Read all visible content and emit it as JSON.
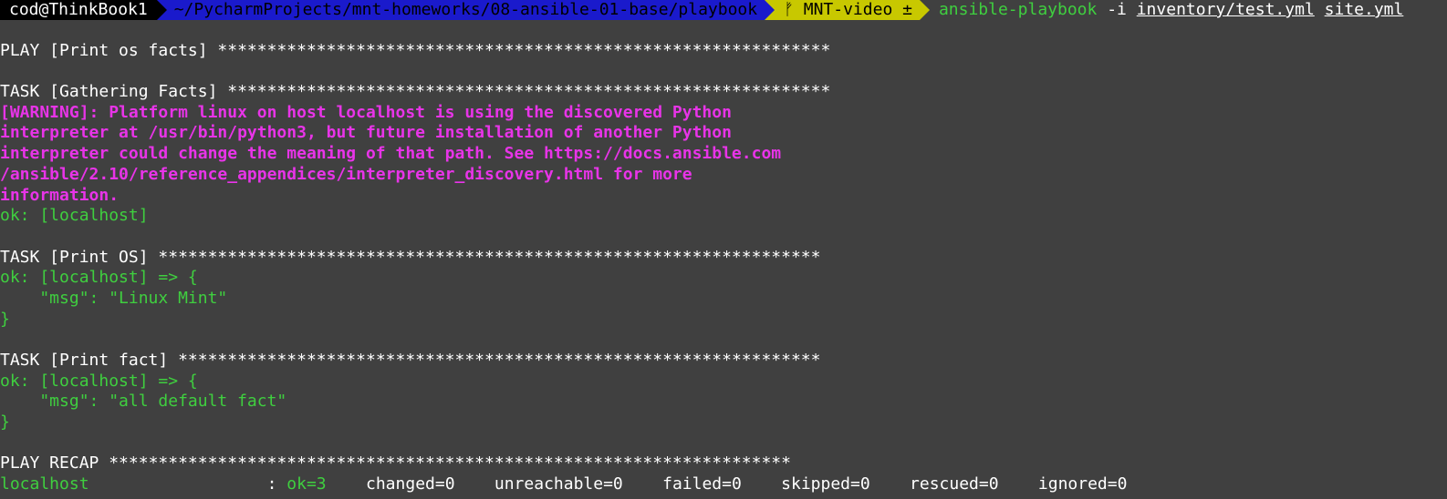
{
  "prompt": {
    "user_host": "cod@ThinkBook1",
    "path": "~/PycharmProjects/mnt-homeworks/08-ansible-01-base/playbook",
    "branch": "ᚠ MNT-video ±",
    "command": "ansible-playbook",
    "flag": "-i",
    "inventory": "inventory/test.yml",
    "playbook": "site.yml"
  },
  "output": {
    "play_header": "PLAY [Print os facts] ",
    "play_stars": "**************************************************************",
    "task1_header": "TASK [Gathering Facts] ",
    "task1_stars": "*************************************************************",
    "warning_lines": [
      "[WARNING]: Platform linux on host localhost is using the discovered Python",
      "interpreter at /usr/bin/python3, but future installation of another Python",
      "interpreter could change the meaning of that path. See https://docs.ansible.com",
      "/ansible/2.10/reference_appendices/interpreter_discovery.html for more",
      "information."
    ],
    "task1_result": "ok: [localhost]",
    "task2_header": "TASK [Print OS] ",
    "task2_stars": "*******************************************************************",
    "task2_result": "ok: [localhost] => {",
    "task2_msg": "    \"msg\": \"Linux Mint\"",
    "task2_close": "}",
    "task3_header": "TASK [Print fact] ",
    "task3_stars": "*****************************************************************",
    "task3_result": "ok: [localhost] => {",
    "task3_msg": "    \"msg\": \"all default fact\"",
    "task3_close": "}",
    "recap_header": "PLAY RECAP ",
    "recap_stars": "*********************************************************************",
    "recap_host": "localhost                  : ",
    "recap_ok": "ok=3",
    "recap_rest": "    changed=0    unreachable=0    failed=0    skipped=0    rescued=0    ignored=0"
  },
  "colors": {
    "background": "#404040",
    "green": "#3fcf3f",
    "magenta": "#e834e8",
    "path_bg": "#1a1acc",
    "git_bg": "#c8c800"
  }
}
